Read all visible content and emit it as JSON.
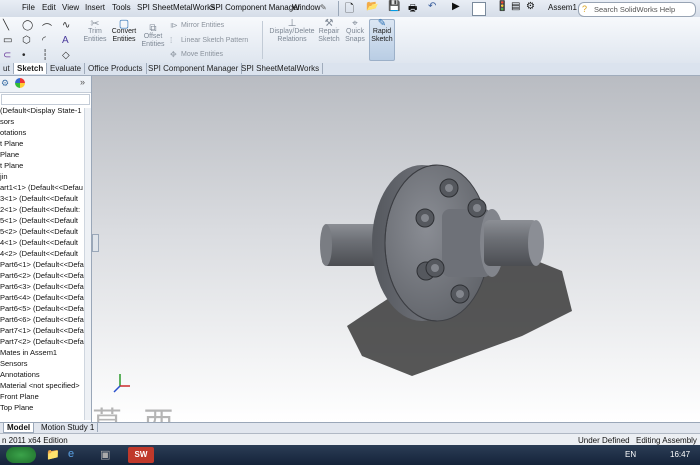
{
  "menu": [
    "File",
    "Edit",
    "View",
    "Insert",
    "Tools",
    "SPI SheetMetalWorks",
    "SPI Component Manager",
    "Window"
  ],
  "document_name": "Assem1",
  "search_placeholder": "Search SolidWorks Help",
  "ribbon": {
    "trim": "Trim\nEntities",
    "convert": "Convert\nEntities",
    "offset": "Offset\nEntities",
    "mirror": "Mirror Entities",
    "linear": "Linear Sketch Pattern",
    "move": "Move Entities",
    "display_delete": "Display/Delete\nRelations",
    "repair": "Repair\nSketch",
    "quick": "Quick\nSnaps",
    "rapid": "Rapid\nSketch"
  },
  "tabs": [
    "ut",
    "Sketch",
    "Evaluate",
    "Office Products",
    "SPI Component Manager",
    "SPI SheetMetalWorks"
  ],
  "active_tab": "Sketch",
  "tree": [
    "(Default<Display State-1",
    "sors",
    "otations",
    "t Plane",
    "Plane",
    "t Plane",
    "jin",
    "art1<1> (Default<<Defau",
    "3<1> (Default<<Default",
    "2<1> (Default<<Default:",
    "5<1> (Default<<Default",
    "5<2> (Default<<Default",
    "4<1> (Default<<Default",
    "4<2> (Default<<Default",
    "Part6<1> (Default<<Defau",
    "Part6<2> (Default<<Defau",
    "Part6<3> (Default<<Defau",
    "Part6<4> (Default<<Defau",
    "Part6<5> (Default<<Defau",
    "Part6<6> (Default<<Defau",
    "Part7<1> (Default<<Defau",
    "Part7<2> (Default<<Defau",
    "Mates in Assem1",
    "Sensors",
    "Annotations",
    "Material <not specified>",
    "Front Plane",
    "Top Plane"
  ],
  "bottom_tabs": [
    "Model",
    "Motion Study 1"
  ],
  "status": {
    "left": "n 2011 x64 Edition",
    "under_defined": "Under Defined",
    "editing": "Editing Assembly"
  },
  "taskbar": {
    "lang": "EN",
    "time": "16:47"
  },
  "watermark": "莫 西 网",
  "colors": {
    "accent": "#3a6ea5",
    "part": "#6a6d74",
    "shadow": "#4a4a4a"
  }
}
